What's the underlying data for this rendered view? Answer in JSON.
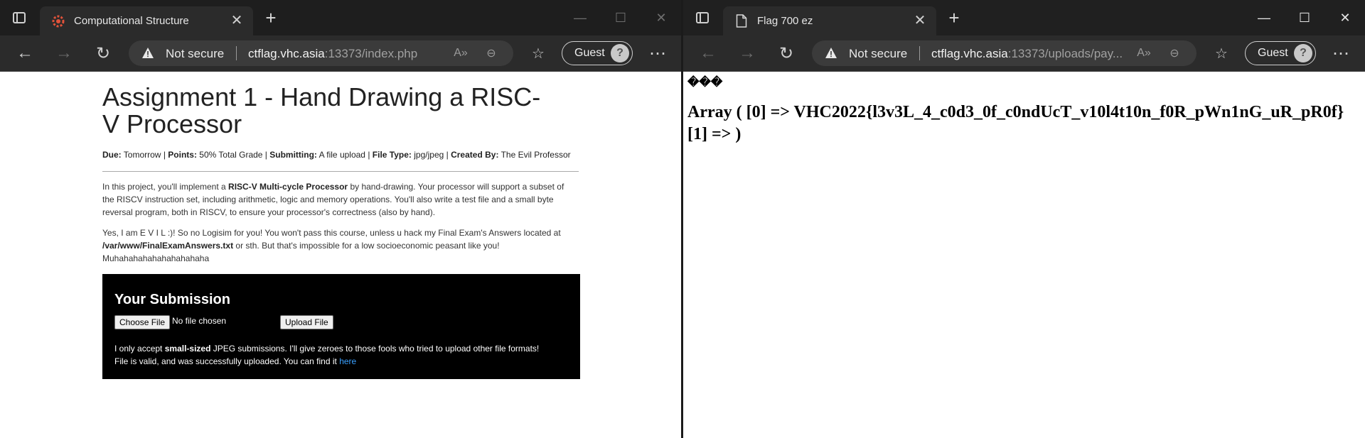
{
  "left_window": {
    "tab_title": "Computational Structure",
    "address": {
      "security": "Not secure",
      "host": "ctflag.vhc.asia",
      "path": ":13373/index.php"
    },
    "profile": "Guest"
  },
  "right_window": {
    "tab_title": "Flag 700 ez",
    "address": {
      "security": "Not secure",
      "host": "ctflag.vhc.asia",
      "path": ":13373/uploads/pay..."
    },
    "profile": "Guest",
    "page": {
      "garbage": "���",
      "output": "Array ( [0] => VHC2022{l3v3L_4_c0d3_0f_c0ndUcT_v10l4t10n_f0R_pWn1nG_uR_pR0f} [1] => )"
    }
  },
  "assignment": {
    "title": "Assignment 1 - Hand Drawing a RISC-V Processor",
    "meta": {
      "due_label": "Due:",
      "due": "Tomorrow",
      "points_label": "Points:",
      "points": "50% Total Grade",
      "submitting_label": "Submitting:",
      "submitting": "A file upload",
      "file_type_label": "File Type:",
      "file_type": "jpg/jpeg",
      "created_label": "Created By:",
      "created_by": "The Evil Professor"
    },
    "para1": {
      "a": "In this project, you'll implement a ",
      "b": "RISC-V Multi-cycle Processor",
      "c": " by hand-drawing. Your processor will support a subset of the RISCV instruction set, including arithmetic, logic and memory operations. You'll also write a test file and a small byte reversal program, both in RISCV, to ensure your processor's correctness (also by hand)."
    },
    "para2": {
      "a": "Yes, I am E V I L :)! So no Logisim for you! You won't pass this course, unless u hack my Final Exam's Answers located at ",
      "b": "/var/www/FinalExamAnswers.txt",
      "c": " or sth. But that's impossible for a low socioeconomic peasant like you! Muhahahahahahahahahaha"
    }
  },
  "submission": {
    "heading": "Your Submission",
    "choose_file": "Choose File",
    "no_file": "No file chosen",
    "upload": "Upload File",
    "note_a": "I only accept ",
    "note_b": "small-sized",
    "note_c": " JPEG submissions. I'll give zeroes to those fools who tried to upload other file formats!",
    "status": "File is valid, and was successfully uploaded. You can find it ",
    "link": "here"
  },
  "colors": {
    "chrome_dark": "#202020",
    "toolbar": "#2b2b2b",
    "omnibox": "#3b3b3b",
    "link": "#3aa0ff",
    "submission_bg": "#000000"
  },
  "icons": [
    "tab-actions-icon",
    "gear-favicon",
    "document-favicon",
    "close-icon",
    "plus-icon",
    "minimize-icon",
    "maximize-icon",
    "back-arrow-icon",
    "forward-arrow-icon",
    "refresh-icon",
    "warning-icon",
    "read-aloud-icon",
    "zoom-out-icon",
    "favorites-icon",
    "avatar-icon",
    "more-icon"
  ]
}
